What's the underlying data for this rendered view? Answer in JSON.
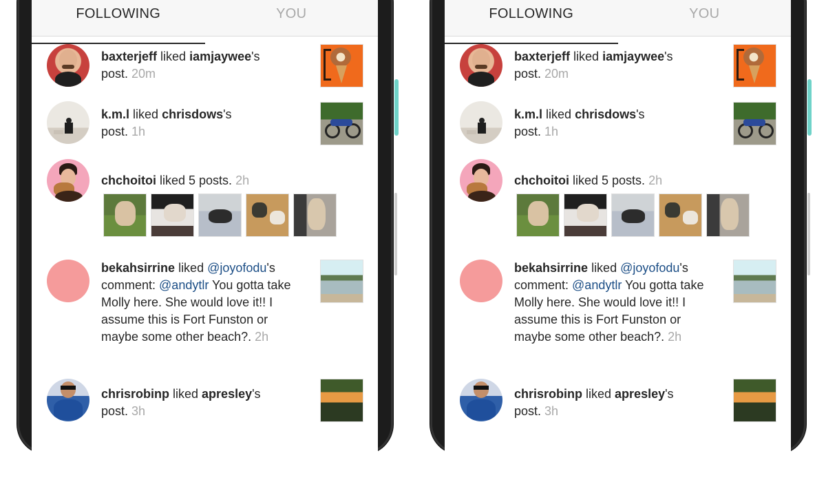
{
  "tabs": [
    {
      "label": "FOLLOWING",
      "active": true
    },
    {
      "label": "YOU",
      "active": false
    }
  ],
  "feed": [
    {
      "user": "baxterjeff",
      "verb": " liked ",
      "target": "iamjaywee",
      "suffix": "'s",
      "line2": "post. ",
      "time": "20m"
    },
    {
      "user": "k.m.l",
      "verb": " liked ",
      "target": "chrisdows",
      "suffix": "'s",
      "line2": "post. ",
      "time": "1h"
    },
    {
      "user": "chchoitoi",
      "verb": " liked 5 posts. ",
      "time": "2h"
    },
    {
      "user": "bekahsirrine",
      "verb": " liked ",
      "mention1": "@joyofodu",
      "suffix": "'s",
      "comment_prefix": "comment: ",
      "mention2": "@andytlr",
      "comment": " You gotta take Molly here. She would love it!! I assume this is Fort Funston or maybe some other beach?. ",
      "time": "2h"
    },
    {
      "user": "chrisrobinp",
      "verb": " liked ",
      "target": "apresley",
      "suffix": "'s",
      "line2": "post. ",
      "time": "3h"
    }
  ],
  "colors": {
    "username": "#262626",
    "timestamp": "#a8a8a8",
    "mention": "#1c4e86",
    "placeholder_avatar": "#f59b9b",
    "phone_side_button": "#6fd3c9"
  }
}
